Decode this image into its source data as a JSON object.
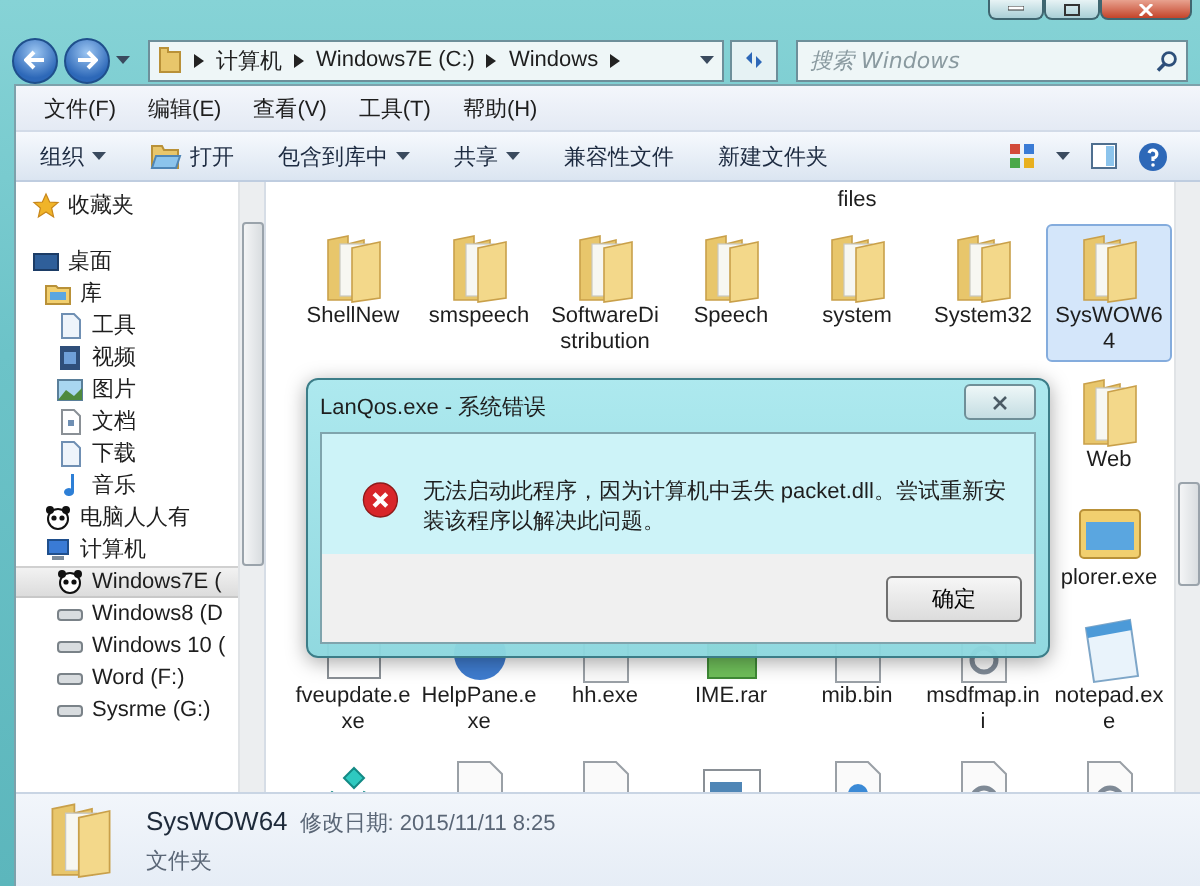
{
  "address_bar": {
    "crumbs": [
      "计算机",
      "Windows7E (C:)",
      "Windows"
    ]
  },
  "search": {
    "placeholder": "搜索 Windows"
  },
  "menu": [
    "文件(F)",
    "编辑(E)",
    "查看(V)",
    "工具(T)",
    "帮助(H)"
  ],
  "toolbar": [
    {
      "label": "组织",
      "kind": "plain",
      "dropdown": true
    },
    {
      "label": "打开",
      "kind": "open",
      "dropdown": false
    },
    {
      "label": "包含到库中",
      "kind": "plain",
      "dropdown": true
    },
    {
      "label": "共享",
      "kind": "plain",
      "dropdown": true
    },
    {
      "label": "兼容性文件",
      "kind": "plain",
      "dropdown": false
    },
    {
      "label": "新建文件夹",
      "kind": "plain",
      "dropdown": false
    }
  ],
  "sidebar": {
    "items": [
      {
        "label": "收藏夹",
        "kind": "star",
        "selected": false
      },
      {
        "label": "桌面",
        "kind": "desktop",
        "selected": false,
        "children": [
          {
            "label": "库",
            "kind": "library",
            "selected": false,
            "children": [
              {
                "label": "工具",
                "kind": "doc",
                "selected": false
              },
              {
                "label": "视频",
                "kind": "video",
                "selected": false
              },
              {
                "label": "图片",
                "kind": "picture",
                "selected": false
              },
              {
                "label": "文档",
                "kind": "text",
                "selected": false
              },
              {
                "label": "下载",
                "kind": "doc",
                "selected": false
              },
              {
                "label": "音乐",
                "kind": "music",
                "selected": false
              }
            ]
          },
          {
            "label": "电脑人人有",
            "kind": "panda",
            "selected": false
          },
          {
            "label": "计算机",
            "kind": "computer",
            "selected": false,
            "children": [
              {
                "label": "Windows7E (",
                "kind": "panda",
                "selected": true
              },
              {
                "label": "Windows8 (D",
                "kind": "drive",
                "selected": false
              },
              {
                "label": "Windows 10 (",
                "kind": "drive",
                "selected": false
              },
              {
                "label": "Word (F:)",
                "kind": "drive",
                "selected": false
              },
              {
                "label": "Sysrme (G:)",
                "kind": "drive",
                "selected": false
              }
            ]
          }
        ]
      }
    ]
  },
  "files": {
    "rows": [
      [
        {
          "kind": "cut"
        },
        {
          "kind": "cut"
        },
        {
          "kind": "cut"
        },
        {
          "kind": "cut"
        },
        {
          "kind": "cut",
          "label": "files"
        },
        {
          "kind": "cut"
        },
        {
          "kind": "cut"
        }
      ],
      [
        {
          "kind": "folder",
          "label": "ShellNew",
          "selected": false
        },
        {
          "kind": "folder",
          "label": "smspeech",
          "selected": false
        },
        {
          "kind": "folder",
          "label": "SoftwareDistribution",
          "selected": false
        },
        {
          "kind": "folder",
          "label": "Speech",
          "selected": false
        },
        {
          "kind": "folder",
          "label": "system",
          "selected": false
        },
        {
          "kind": "folder",
          "label": "System32",
          "selected": false
        },
        {
          "kind": "folder",
          "label": "SysWOW64",
          "selected": true
        }
      ],
      [
        {
          "kind": "hidden"
        },
        {
          "kind": "hidden"
        },
        {
          "kind": "hidden"
        },
        {
          "kind": "hidden"
        },
        {
          "kind": "hidden"
        },
        {
          "kind": "hidden"
        },
        {
          "kind": "folder",
          "label": "Web",
          "selected": false
        }
      ],
      [
        {
          "kind": "hidden"
        },
        {
          "kind": "hidden"
        },
        {
          "kind": "hidden"
        },
        {
          "kind": "hidden"
        },
        {
          "kind": "hidden"
        },
        {
          "kind": "hidden"
        },
        {
          "kind": "explorer",
          "label": "plorer.exe",
          "selected": false
        }
      ],
      [
        {
          "kind": "exe",
          "label": "fveupdate.exe",
          "selected": false
        },
        {
          "kind": "help",
          "label": "HelpPane.exe",
          "selected": false
        },
        {
          "kind": "doc",
          "label": "hh.exe",
          "selected": false
        },
        {
          "kind": "archive",
          "label": "IME.rar",
          "selected": false
        },
        {
          "kind": "doc",
          "label": "mib.bin",
          "selected": false
        },
        {
          "kind": "gear",
          "label": "msdfmap.ini",
          "selected": false
        },
        {
          "kind": "notepad",
          "label": "notepad.exe",
          "selected": false
        }
      ],
      [
        {
          "kind": "gems"
        },
        {
          "kind": "doc"
        },
        {
          "kind": "doc"
        },
        {
          "kind": "window"
        },
        {
          "kind": "web"
        },
        {
          "kind": "gear"
        },
        {
          "kind": "gear"
        }
      ]
    ]
  },
  "dialog": {
    "title": "LanQos.exe - 系统错误",
    "message": "无法启动此程序，因为计算机中丢失 packet.dll。尝试重新安装该程序以解决此问题。",
    "button": "确定"
  },
  "details": {
    "name": "SysWOW64",
    "modified": "修改日期: 2015/11/11 8:25",
    "type": "文件夹"
  }
}
